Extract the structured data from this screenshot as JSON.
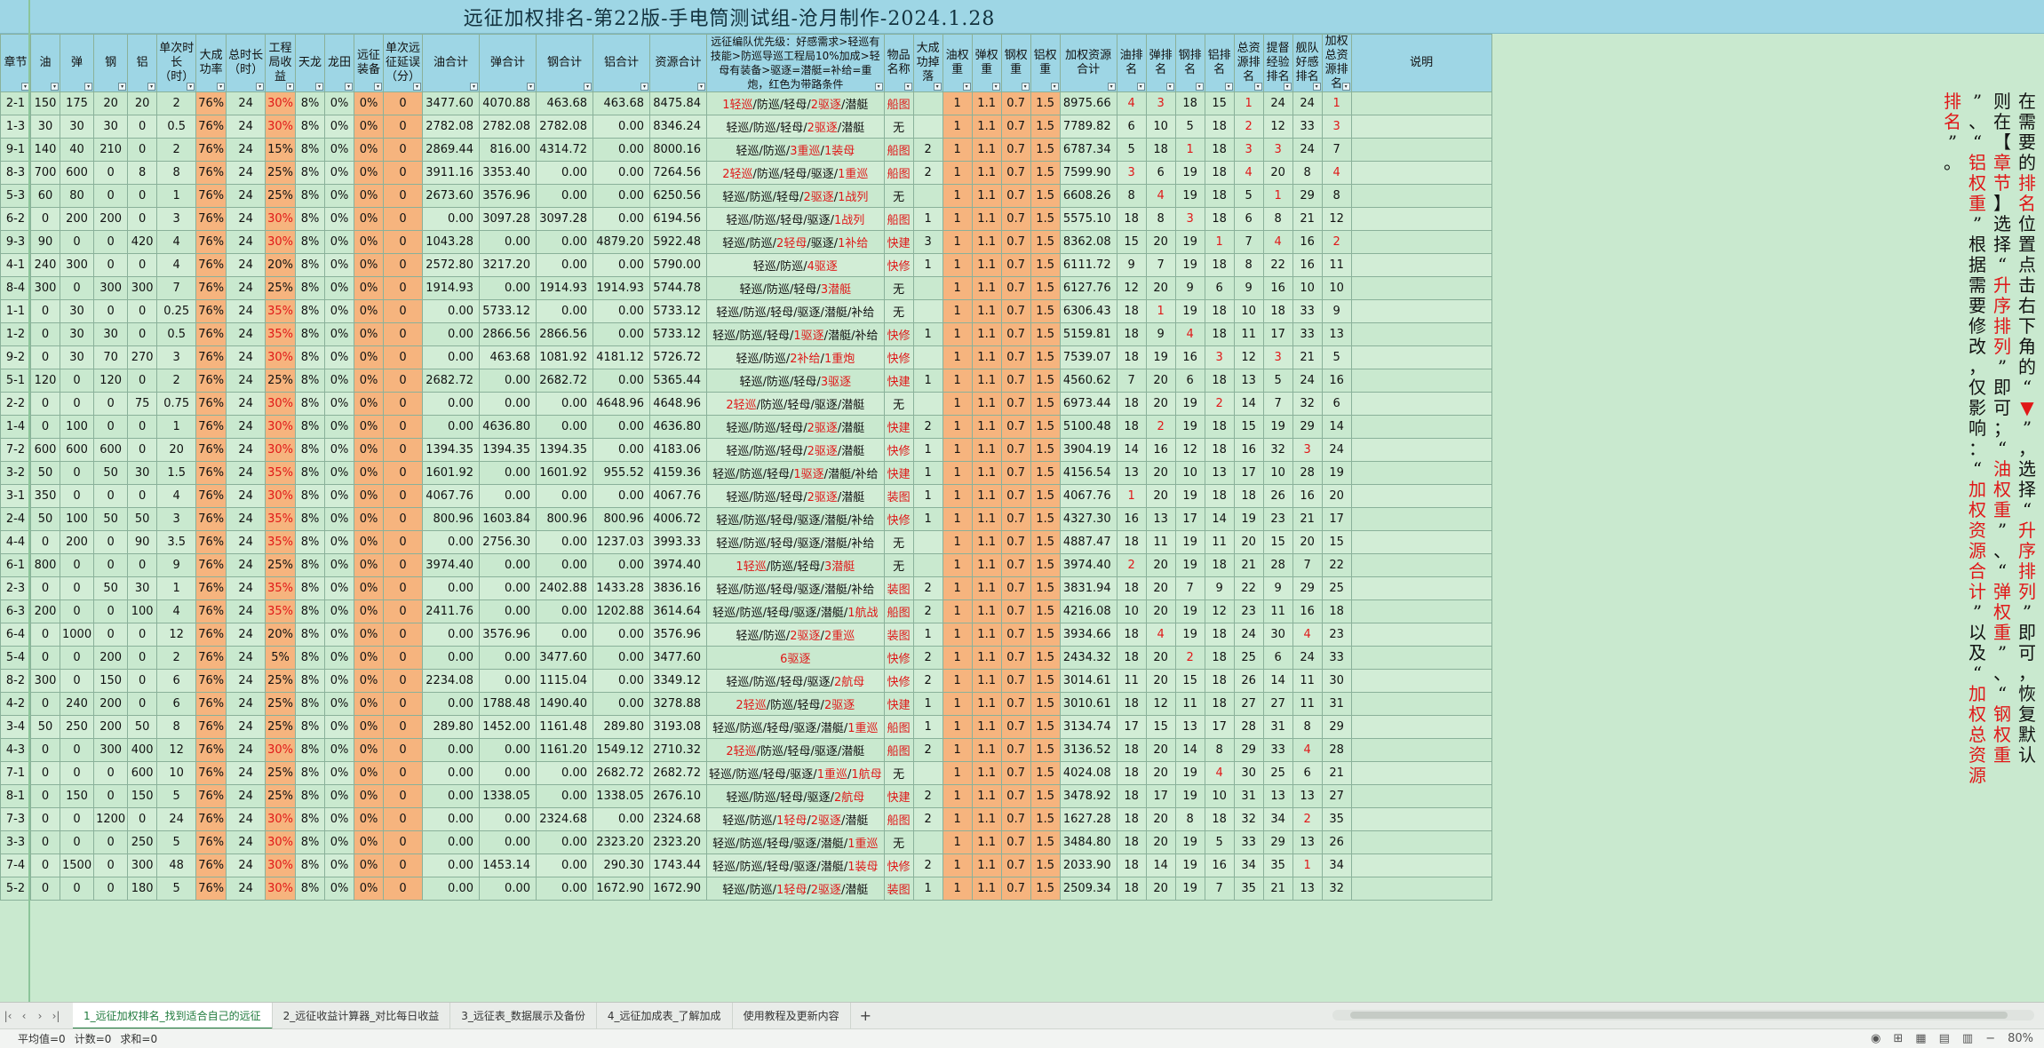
{
  "title": "远征加权排名-第22版-手电筒测试组-沧月制作-2024.1.28",
  "headers": [
    "章节",
    "油",
    "弹",
    "钢",
    "铝",
    "单次时长（时）",
    "大成功率",
    "总时长（时）",
    "工程局收益",
    "天龙",
    "龙田",
    "远征装备",
    "单次远征延误（分）",
    "油合计",
    "弹合计",
    "钢合计",
    "铝合计",
    "资源合计",
    "远征编队优先级：好感需求>轻巡有技能>防巡导巡工程局10%加成>轻母有装备>驱逐=潜艇=补给=重炮，红色为带路条件",
    "物品名称",
    "大成功掉落",
    "油权重",
    "弹权重",
    "钢权重",
    "铝权重",
    "加权资源合计",
    "油排名",
    "弹排名",
    "钢排名",
    "铝排名",
    "总资源排名",
    "提督经验排名",
    "舰队好感排名",
    "加权总资源排名",
    "说明"
  ],
  "rows": [
    [
      "2-1",
      "150",
      "175",
      "20",
      "20",
      "2",
      "76%",
      "24",
      "30%",
      "8%",
      "0%",
      "0%",
      "0",
      "3477.60",
      "4070.88",
      "463.68",
      "463.68",
      "8475.84",
      "1轻巡/防巡/轻母/2驱逐/潜艇",
      "船图",
      "",
      "1",
      "1.1",
      "0.7",
      "1.5",
      "8975.66",
      "4",
      "3",
      "18",
      "15",
      "1",
      "24",
      "24",
      "1"
    ],
    [
      "1-3",
      "30",
      "30",
      "30",
      "0",
      "0.5",
      "76%",
      "24",
      "30%",
      "8%",
      "0%",
      "0%",
      "0",
      "2782.08",
      "2782.08",
      "2782.08",
      "0.00",
      "8346.24",
      "轻巡/防巡/轻母/2驱逐/潜艇",
      "无",
      "",
      "1",
      "1.1",
      "0.7",
      "1.5",
      "7789.82",
      "6",
      "10",
      "5",
      "18",
      "2",
      "12",
      "33",
      "3"
    ],
    [
      "9-1",
      "140",
      "40",
      "210",
      "0",
      "2",
      "76%",
      "24",
      "15%",
      "8%",
      "0%",
      "0%",
      "0",
      "2869.44",
      "816.00",
      "4314.72",
      "0.00",
      "8000.16",
      "轻巡/防巡/3重巡/1装母",
      "船图",
      "2",
      "1",
      "1.1",
      "0.7",
      "1.5",
      "6787.34",
      "5",
      "18",
      "1",
      "18",
      "3",
      "3",
      "24",
      "7"
    ],
    [
      "8-3",
      "700",
      "600",
      "0",
      "8",
      "8",
      "76%",
      "24",
      "25%",
      "8%",
      "0%",
      "0%",
      "0",
      "3911.16",
      "3353.40",
      "0.00",
      "0.00",
      "7264.56",
      "2轻巡/防巡/轻母/驱逐/1重巡",
      "船图",
      "2",
      "1",
      "1.1",
      "0.7",
      "1.5",
      "7599.90",
      "3",
      "6",
      "19",
      "18",
      "4",
      "20",
      "8",
      "4"
    ],
    [
      "5-3",
      "60",
      "80",
      "0",
      "0",
      "1",
      "76%",
      "24",
      "25%",
      "8%",
      "0%",
      "0%",
      "0",
      "2673.60",
      "3576.96",
      "0.00",
      "0.00",
      "6250.56",
      "轻巡/防巡/轻母/2驱逐/1战列",
      "无",
      "",
      "1",
      "1.1",
      "0.7",
      "1.5",
      "6608.26",
      "8",
      "4",
      "19",
      "18",
      "5",
      "1",
      "29",
      "8"
    ],
    [
      "6-2",
      "0",
      "200",
      "200",
      "0",
      "3",
      "76%",
      "24",
      "30%",
      "8%",
      "0%",
      "0%",
      "0",
      "0.00",
      "3097.28",
      "3097.28",
      "0.00",
      "6194.56",
      "轻巡/防巡/轻母/驱逐/1战列",
      "船图",
      "1",
      "1",
      "1.1",
      "0.7",
      "1.5",
      "5575.10",
      "18",
      "8",
      "3",
      "18",
      "6",
      "8",
      "21",
      "12"
    ],
    [
      "9-3",
      "90",
      "0",
      "0",
      "420",
      "4",
      "76%",
      "24",
      "30%",
      "8%",
      "0%",
      "0%",
      "0",
      "1043.28",
      "0.00",
      "0.00",
      "4879.20",
      "5922.48",
      "轻巡/防巡/2轻母/驱逐/1补给",
      "快建",
      "3",
      "1",
      "1.1",
      "0.7",
      "1.5",
      "8362.08",
      "15",
      "20",
      "19",
      "1",
      "7",
      "4",
      "16",
      "2"
    ],
    [
      "4-1",
      "240",
      "300",
      "0",
      "0",
      "4",
      "76%",
      "24",
      "20%",
      "8%",
      "0%",
      "0%",
      "0",
      "2572.80",
      "3217.20",
      "0.00",
      "0.00",
      "5790.00",
      "轻巡/防巡/4驱逐",
      "快修",
      "1",
      "1",
      "1.1",
      "0.7",
      "1.5",
      "6111.72",
      "9",
      "7",
      "19",
      "18",
      "8",
      "22",
      "16",
      "11"
    ],
    [
      "8-4",
      "300",
      "0",
      "300",
      "300",
      "7",
      "76%",
      "24",
      "25%",
      "8%",
      "0%",
      "0%",
      "0",
      "1914.93",
      "0.00",
      "1914.93",
      "1914.93",
      "5744.78",
      "轻巡/防巡/轻母/3潜艇",
      "无",
      "",
      "1",
      "1.1",
      "0.7",
      "1.5",
      "6127.76",
      "12",
      "20",
      "9",
      "6",
      "9",
      "16",
      "10",
      "10"
    ],
    [
      "1-1",
      "0",
      "30",
      "0",
      "0",
      "0.25",
      "76%",
      "24",
      "35%",
      "8%",
      "0%",
      "0%",
      "0",
      "0.00",
      "5733.12",
      "0.00",
      "0.00",
      "5733.12",
      "轻巡/防巡/轻母/驱逐/潜艇/补给",
      "无",
      "",
      "1",
      "1.1",
      "0.7",
      "1.5",
      "6306.43",
      "18",
      "1",
      "19",
      "18",
      "10",
      "18",
      "33",
      "9"
    ],
    [
      "1-2",
      "0",
      "30",
      "30",
      "0",
      "0.5",
      "76%",
      "24",
      "35%",
      "8%",
      "0%",
      "0%",
      "0",
      "0.00",
      "2866.56",
      "2866.56",
      "0.00",
      "5733.12",
      "轻巡/防巡/轻母/1驱逐/潜艇/补给",
      "快修",
      "1",
      "1",
      "1.1",
      "0.7",
      "1.5",
      "5159.81",
      "18",
      "9",
      "4",
      "18",
      "11",
      "17",
      "33",
      "13"
    ],
    [
      "9-2",
      "0",
      "30",
      "70",
      "270",
      "3",
      "76%",
      "24",
      "30%",
      "8%",
      "0%",
      "0%",
      "0",
      "0.00",
      "463.68",
      "1081.92",
      "4181.12",
      "5726.72",
      "轻巡/防巡/2补给/1重炮",
      "快修",
      "",
      "1",
      "1.1",
      "0.7",
      "1.5",
      "7539.07",
      "18",
      "19",
      "16",
      "3",
      "12",
      "3",
      "21",
      "5"
    ],
    [
      "5-1",
      "120",
      "0",
      "120",
      "0",
      "2",
      "76%",
      "24",
      "25%",
      "8%",
      "0%",
      "0%",
      "0",
      "2682.72",
      "0.00",
      "2682.72",
      "0.00",
      "5365.44",
      "轻巡/防巡/轻母/3驱逐",
      "快建",
      "1",
      "1",
      "1.1",
      "0.7",
      "1.5",
      "4560.62",
      "7",
      "20",
      "6",
      "18",
      "13",
      "5",
      "24",
      "16"
    ],
    [
      "2-2",
      "0",
      "0",
      "0",
      "75",
      "0.75",
      "76%",
      "24",
      "30%",
      "8%",
      "0%",
      "0%",
      "0",
      "0.00",
      "0.00",
      "0.00",
      "4648.96",
      "4648.96",
      "2轻巡/防巡/轻母/驱逐/潜艇",
      "无",
      "",
      "1",
      "1.1",
      "0.7",
      "1.5",
      "6973.44",
      "18",
      "20",
      "19",
      "2",
      "14",
      "7",
      "32",
      "6"
    ],
    [
      "1-4",
      "0",
      "100",
      "0",
      "0",
      "1",
      "76%",
      "24",
      "30%",
      "8%",
      "0%",
      "0%",
      "0",
      "0.00",
      "4636.80",
      "0.00",
      "0.00",
      "4636.80",
      "轻巡/防巡/轻母/2驱逐/潜艇",
      "快建",
      "2",
      "1",
      "1.1",
      "0.7",
      "1.5",
      "5100.48",
      "18",
      "2",
      "19",
      "18",
      "15",
      "19",
      "29",
      "14"
    ],
    [
      "7-2",
      "600",
      "600",
      "600",
      "0",
      "20",
      "76%",
      "24",
      "30%",
      "8%",
      "0%",
      "0%",
      "0",
      "1394.35",
      "1394.35",
      "1394.35",
      "0.00",
      "4183.06",
      "轻巡/防巡/轻母/2驱逐/潜艇",
      "快修",
      "1",
      "1",
      "1.1",
      "0.7",
      "1.5",
      "3904.19",
      "14",
      "16",
      "12",
      "18",
      "16",
      "32",
      "3",
      "24"
    ],
    [
      "3-2",
      "50",
      "0",
      "50",
      "30",
      "1.5",
      "76%",
      "24",
      "35%",
      "8%",
      "0%",
      "0%",
      "0",
      "1601.92",
      "0.00",
      "1601.92",
      "955.52",
      "4159.36",
      "轻巡/防巡/轻母/1驱逐/潜艇/补给",
      "快建",
      "1",
      "1",
      "1.1",
      "0.7",
      "1.5",
      "4156.54",
      "13",
      "20",
      "10",
      "13",
      "17",
      "10",
      "28",
      "19"
    ],
    [
      "3-1",
      "350",
      "0",
      "0",
      "0",
      "4",
      "76%",
      "24",
      "30%",
      "8%",
      "0%",
      "0%",
      "0",
      "4067.76",
      "0.00",
      "0.00",
      "0.00",
      "4067.76",
      "轻巡/防巡/轻母/2驱逐/潜艇",
      "装图",
      "1",
      "1",
      "1.1",
      "0.7",
      "1.5",
      "4067.76",
      "1",
      "20",
      "19",
      "18",
      "18",
      "26",
      "16",
      "20"
    ],
    [
      "2-4",
      "50",
      "100",
      "50",
      "50",
      "3",
      "76%",
      "24",
      "35%",
      "8%",
      "0%",
      "0%",
      "0",
      "800.96",
      "1603.84",
      "800.96",
      "800.96",
      "4006.72",
      "轻巡/防巡/轻母/驱逐/潜艇/补给",
      "快修",
      "1",
      "1",
      "1.1",
      "0.7",
      "1.5",
      "4327.30",
      "16",
      "13",
      "17",
      "14",
      "19",
      "23",
      "21",
      "17"
    ],
    [
      "4-4",
      "0",
      "200",
      "0",
      "90",
      "3.5",
      "76%",
      "24",
      "35%",
      "8%",
      "0%",
      "0%",
      "0",
      "0.00",
      "2756.30",
      "0.00",
      "1237.03",
      "3993.33",
      "轻巡/防巡/轻母/驱逐/潜艇/补给",
      "无",
      "",
      "1",
      "1.1",
      "0.7",
      "1.5",
      "4887.47",
      "18",
      "11",
      "19",
      "11",
      "20",
      "15",
      "20",
      "15"
    ],
    [
      "6-1",
      "800",
      "0",
      "0",
      "0",
      "9",
      "76%",
      "24",
      "25%",
      "8%",
      "0%",
      "0%",
      "0",
      "3974.40",
      "0.00",
      "0.00",
      "0.00",
      "3974.40",
      "1轻巡/防巡/轻母/3潜艇",
      "无",
      "",
      "1",
      "1.1",
      "0.7",
      "1.5",
      "3974.40",
      "2",
      "20",
      "19",
      "18",
      "21",
      "28",
      "7",
      "22"
    ],
    [
      "2-3",
      "0",
      "0",
      "50",
      "30",
      "1",
      "76%",
      "24",
      "35%",
      "8%",
      "0%",
      "0%",
      "0",
      "0.00",
      "0.00",
      "2402.88",
      "1433.28",
      "3836.16",
      "轻巡/防巡/轻母/驱逐/潜艇/补给",
      "装图",
      "2",
      "1",
      "1.1",
      "0.7",
      "1.5",
      "3831.94",
      "18",
      "20",
      "7",
      "9",
      "22",
      "9",
      "29",
      "25"
    ],
    [
      "6-3",
      "200",
      "0",
      "0",
      "100",
      "4",
      "76%",
      "24",
      "35%",
      "8%",
      "0%",
      "0%",
      "0",
      "2411.76",
      "0.00",
      "0.00",
      "1202.88",
      "3614.64",
      "轻巡/防巡/轻母/驱逐/潜艇/1航战",
      "船图",
      "2",
      "1",
      "1.1",
      "0.7",
      "1.5",
      "4216.08",
      "10",
      "20",
      "19",
      "12",
      "23",
      "11",
      "16",
      "18"
    ],
    [
      "6-4",
      "0",
      "1000",
      "0",
      "0",
      "12",
      "76%",
      "24",
      "20%",
      "8%",
      "0%",
      "0%",
      "0",
      "0.00",
      "3576.96",
      "0.00",
      "0.00",
      "3576.96",
      "轻巡/防巡/2驱逐/2重巡",
      "装图",
      "1",
      "1",
      "1.1",
      "0.7",
      "1.5",
      "3934.66",
      "18",
      "4",
      "19",
      "18",
      "24",
      "30",
      "4",
      "23"
    ],
    [
      "5-4",
      "0",
      "0",
      "200",
      "0",
      "2",
      "76%",
      "24",
      "5%",
      "8%",
      "0%",
      "0%",
      "0",
      "0.00",
      "0.00",
      "3477.60",
      "0.00",
      "3477.60",
      "6驱逐",
      "快修",
      "2",
      "1",
      "1.1",
      "0.7",
      "1.5",
      "2434.32",
      "18",
      "20",
      "2",
      "18",
      "25",
      "6",
      "24",
      "33"
    ],
    [
      "8-2",
      "300",
      "0",
      "150",
      "0",
      "6",
      "76%",
      "24",
      "25%",
      "8%",
      "0%",
      "0%",
      "0",
      "2234.08",
      "0.00",
      "1115.04",
      "0.00",
      "3349.12",
      "轻巡/防巡/轻母/驱逐/2航母",
      "快修",
      "2",
      "1",
      "1.1",
      "0.7",
      "1.5",
      "3014.61",
      "11",
      "20",
      "15",
      "18",
      "26",
      "14",
      "11",
      "30"
    ],
    [
      "4-2",
      "0",
      "240",
      "200",
      "0",
      "6",
      "76%",
      "24",
      "25%",
      "8%",
      "0%",
      "0%",
      "0",
      "0.00",
      "1788.48",
      "1490.40",
      "0.00",
      "3278.88",
      "2轻巡/防巡/轻母/2驱逐",
      "快建",
      "1",
      "1",
      "1.1",
      "0.7",
      "1.5",
      "3010.61",
      "18",
      "12",
      "11",
      "18",
      "27",
      "27",
      "11",
      "31"
    ],
    [
      "3-4",
      "50",
      "250",
      "200",
      "50",
      "8",
      "76%",
      "24",
      "25%",
      "8%",
      "0%",
      "0%",
      "0",
      "289.80",
      "1452.00",
      "1161.48",
      "289.80",
      "3193.08",
      "轻巡/防巡/轻母/驱逐/潜艇/1重巡",
      "船图",
      "1",
      "1",
      "1.1",
      "0.7",
      "1.5",
      "3134.74",
      "17",
      "15",
      "13",
      "17",
      "28",
      "31",
      "8",
      "29"
    ],
    [
      "4-3",
      "0",
      "0",
      "300",
      "400",
      "12",
      "76%",
      "24",
      "30%",
      "8%",
      "0%",
      "0%",
      "0",
      "0.00",
      "0.00",
      "1161.20",
      "1549.12",
      "2710.32",
      "2轻巡/防巡/轻母/驱逐/潜艇",
      "船图",
      "2",
      "1",
      "1.1",
      "0.7",
      "1.5",
      "3136.52",
      "18",
      "20",
      "14",
      "8",
      "29",
      "33",
      "4",
      "28"
    ],
    [
      "7-1",
      "0",
      "0",
      "0",
      "600",
      "10",
      "76%",
      "24",
      "25%",
      "8%",
      "0%",
      "0%",
      "0",
      "0.00",
      "0.00",
      "0.00",
      "2682.72",
      "2682.72",
      "轻巡/防巡/轻母/驱逐/1重巡/1航母",
      "无",
      "",
      "1",
      "1.1",
      "0.7",
      "1.5",
      "4024.08",
      "18",
      "20",
      "19",
      "4",
      "30",
      "25",
      "6",
      "21"
    ],
    [
      "8-1",
      "0",
      "150",
      "0",
      "150",
      "5",
      "76%",
      "24",
      "25%",
      "8%",
      "0%",
      "0%",
      "0",
      "0.00",
      "1338.05",
      "0.00",
      "1338.05",
      "2676.10",
      "轻巡/防巡/轻母/驱逐/2航母",
      "快建",
      "2",
      "1",
      "1.1",
      "0.7",
      "1.5",
      "3478.92",
      "18",
      "17",
      "19",
      "10",
      "31",
      "13",
      "13",
      "27"
    ],
    [
      "7-3",
      "0",
      "0",
      "1200",
      "0",
      "24",
      "76%",
      "24",
      "30%",
      "8%",
      "0%",
      "0%",
      "0",
      "0.00",
      "0.00",
      "2324.68",
      "0.00",
      "2324.68",
      "轻巡/防巡/1轻母/2驱逐/潜艇",
      "船图",
      "2",
      "1",
      "1.1",
      "0.7",
      "1.5",
      "1627.28",
      "18",
      "20",
      "8",
      "18",
      "32",
      "34",
      "2",
      "35"
    ],
    [
      "3-3",
      "0",
      "0",
      "0",
      "250",
      "5",
      "76%",
      "24",
      "30%",
      "8%",
      "0%",
      "0%",
      "0",
      "0.00",
      "0.00",
      "0.00",
      "2323.20",
      "2323.20",
      "轻巡/防巡/轻母/驱逐/潜艇/1重巡",
      "无",
      "",
      "1",
      "1.1",
      "0.7",
      "1.5",
      "3484.80",
      "18",
      "20",
      "19",
      "5",
      "33",
      "29",
      "13",
      "26"
    ],
    [
      "7-4",
      "0",
      "1500",
      "0",
      "300",
      "48",
      "76%",
      "24",
      "30%",
      "8%",
      "0%",
      "0%",
      "0",
      "0.00",
      "1453.14",
      "0.00",
      "290.30",
      "1743.44",
      "轻巡/防巡/轻母/驱逐/潜艇/1装母",
      "快修",
      "2",
      "1",
      "1.1",
      "0.7",
      "1.5",
      "2033.90",
      "18",
      "14",
      "19",
      "16",
      "34",
      "35",
      "1",
      "34"
    ],
    [
      "5-2",
      "0",
      "0",
      "0",
      "180",
      "5",
      "76%",
      "24",
      "30%",
      "8%",
      "0%",
      "0%",
      "0",
      "0.00",
      "0.00",
      "0.00",
      "1672.90",
      "1672.90",
      "轻巡/防巡/1轻母/2驱逐/潜艇",
      "装图",
      "1",
      "1",
      "1.1",
      "0.7",
      "1.5",
      "2509.34",
      "18",
      "20",
      "19",
      "7",
      "35",
      "21",
      "13",
      "32"
    ]
  ],
  "strategy_highlights": [
    "1轻巡",
    "2驱逐",
    "3重巡",
    "1装母",
    "2轻巡",
    "1重巡",
    "1战列",
    "2轻母",
    "1补给",
    "4驱逐",
    "3潜艇",
    "1驱逐",
    "2补给",
    "1重炮",
    "3驱逐",
    "1航战",
    "2重巡",
    "6驱逐",
    "2航母",
    "1航母",
    "1轻母"
  ],
  "explanation_columns": [
    [
      "在",
      "需",
      "要",
      "的",
      "排",
      "名",
      "位",
      "置",
      "点",
      "击",
      "右",
      "下",
      "角",
      "的",
      "“",
      "▼",
      "”",
      "，",
      "选",
      "择",
      "“",
      "升",
      "序",
      "排",
      "列",
      "”",
      "即",
      "可",
      "，",
      "恢",
      "复",
      "默",
      "认"
    ],
    [
      "则",
      "在",
      "【",
      "章",
      "节",
      "】",
      "选",
      "择",
      "“",
      "升",
      "序",
      "排",
      "列",
      "”",
      "即",
      "可",
      "；",
      "“",
      "油",
      "权",
      "重",
      "”",
      "、",
      "“",
      "弹",
      "权",
      "重",
      "”",
      "、",
      "“",
      "钢",
      "权",
      "重"
    ],
    [
      "”",
      "、",
      "“",
      "铝",
      "权",
      "重",
      "”",
      "根",
      "据",
      "需",
      "要",
      "修",
      "改",
      "，",
      "仅",
      "影",
      "响",
      "：",
      "“",
      "加",
      "权",
      "资",
      "源",
      "合",
      "计",
      "”",
      "以",
      "及",
      "“",
      "加",
      "权",
      "总",
      "资",
      "源"
    ],
    [
      "排",
      "名",
      "”",
      "。"
    ]
  ],
  "explanation_red": [
    "▼",
    "章",
    "节",
    "升",
    "序",
    "排",
    "列",
    "油",
    "权",
    "重",
    "弹",
    "钢",
    "铝",
    "加",
    "资",
    "源",
    "合",
    "计",
    "总",
    "排",
    "名"
  ],
  "tabs": [
    "1_远征加权排名_找到适合自己的远征",
    "2_远征收益计算器_对比每日收益",
    "3_远征表_数据展示及备份",
    "4_远征加成表_了解加成",
    "使用教程及更新内容"
  ],
  "active_tab": 0,
  "status": {
    "avg": "平均值=0",
    "count": "计数=0",
    "sum": "求和=0",
    "zoom": "80%"
  }
}
